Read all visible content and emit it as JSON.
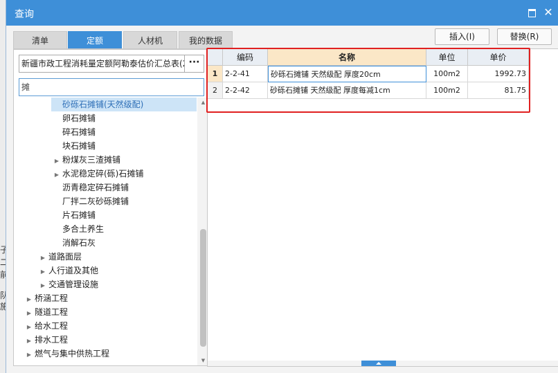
{
  "window": {
    "title": "查询"
  },
  "tabs": [
    {
      "label": "清单"
    },
    {
      "label": "定额"
    },
    {
      "label": "人材机"
    },
    {
      "label": "我的数据"
    }
  ],
  "actions": {
    "insert_label": "插入(I)",
    "replace_label": "替换(R)"
  },
  "library": {
    "selected": "新疆市政工程消耗量定额阿勒泰估价汇总表(2",
    "more_label": "···"
  },
  "search": {
    "value": "摊"
  },
  "tree": [
    {
      "label": "砂砾石摊铺(天然级配)",
      "has_children": false,
      "selected": true
    },
    {
      "label": "卵石摊铺",
      "has_children": false
    },
    {
      "label": "碎石摊铺",
      "has_children": false
    },
    {
      "label": "块石摊铺",
      "has_children": false
    },
    {
      "label": "粉煤灰三渣摊铺",
      "has_children": true
    },
    {
      "label": "水泥稳定碎(砾)石摊铺",
      "has_children": true
    },
    {
      "label": "沥青稳定碎石摊铺",
      "has_children": false
    },
    {
      "label": "厂拌二灰砂砾摊铺",
      "has_children": false
    },
    {
      "label": "片石摊铺",
      "has_children": false
    },
    {
      "label": "多合土养生",
      "has_children": false
    },
    {
      "label": "消解石灰",
      "has_children": false
    },
    {
      "label": "道路面层",
      "has_children": true
    },
    {
      "label": "人行道及其他",
      "has_children": true
    },
    {
      "label": "交通管理设施",
      "has_children": true
    },
    {
      "label": "桥涵工程",
      "has_children": true
    },
    {
      "label": "隧道工程",
      "has_children": true
    },
    {
      "label": "给水工程",
      "has_children": true
    },
    {
      "label": "排水工程",
      "has_children": true
    },
    {
      "label": "燃气与集中供热工程",
      "has_children": true
    }
  ],
  "grid": {
    "columns": [
      "编码",
      "名称",
      "单位",
      "单价"
    ],
    "rows": [
      {
        "no": "1",
        "code": "2-2-41",
        "name": "砂砾石摊铺 天然级配 厚度20cm",
        "unit": "100m2",
        "price": "1992.73"
      },
      {
        "no": "2",
        "code": "2-2-42",
        "name": "砂砾石摊铺 天然级配 厚度每减1cm",
        "unit": "100m2",
        "price": "81.75"
      }
    ]
  },
  "background_glyphs": [
    "子",
    "二",
    "前",
    "队",
    "施"
  ]
}
